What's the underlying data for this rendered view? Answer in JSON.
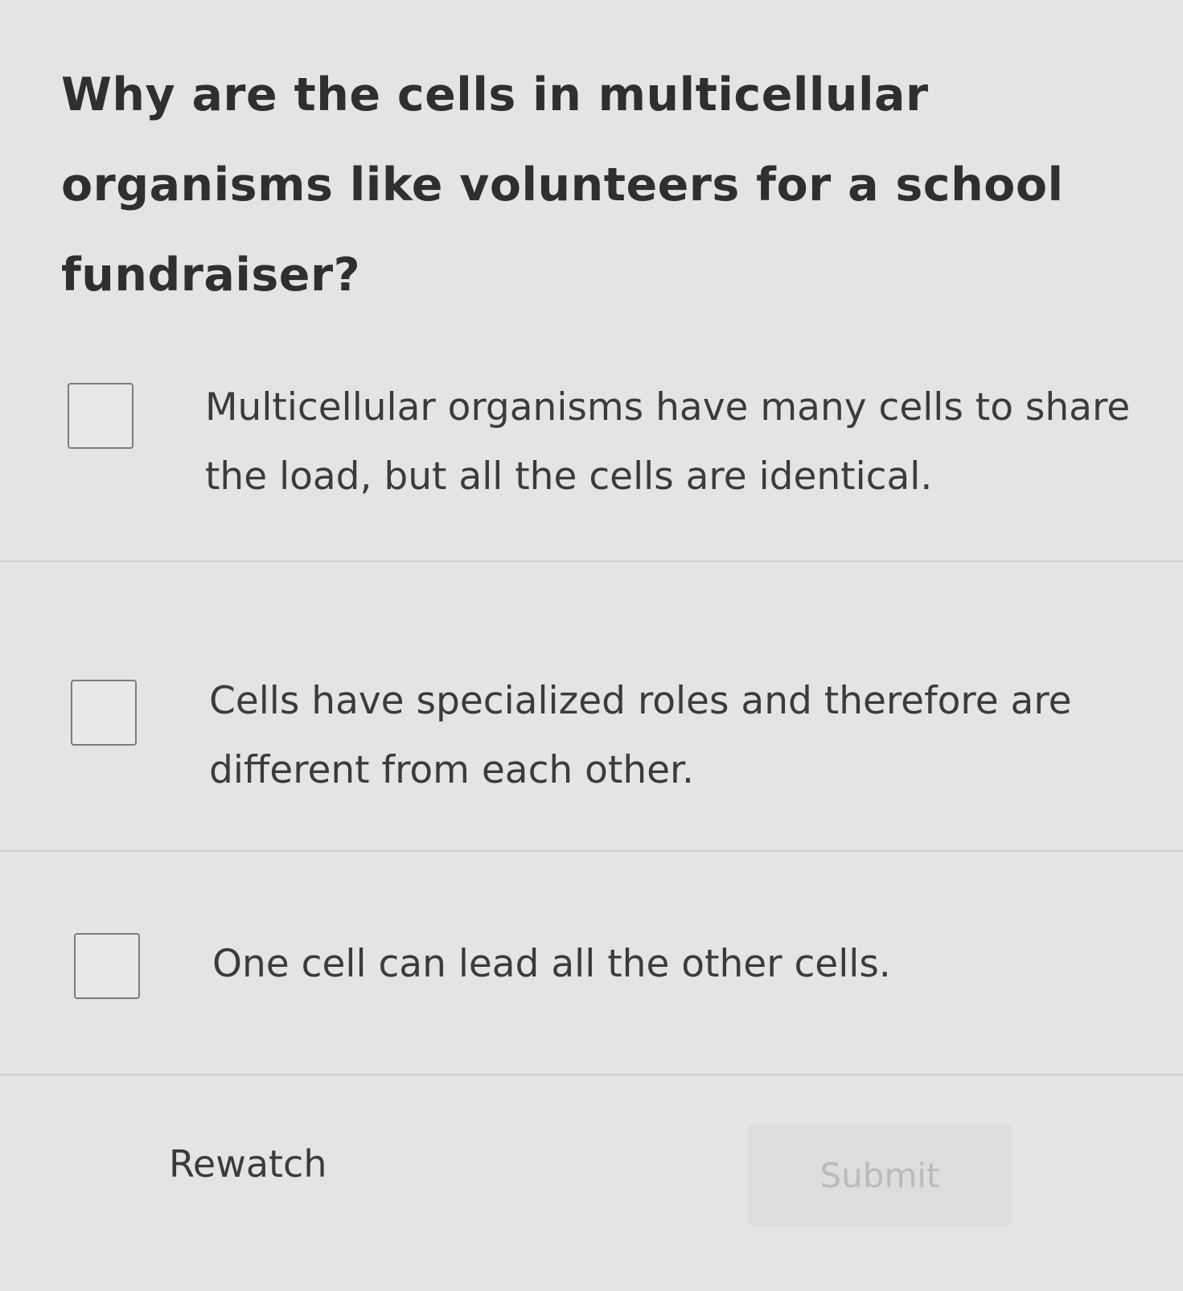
{
  "question": {
    "text": "Why are the cells in multicellular organisms like volunteers for a school fundraiser?"
  },
  "options": [
    {
      "label": "Multicellular organisms have many cells to share the load, but all the cells are identical.",
      "checked": false
    },
    {
      "label": "Cells have specialized roles and therefore are different from each other.",
      "checked": false
    },
    {
      "label": "One cell can lead all the other cells.",
      "checked": false
    }
  ],
  "actions": {
    "rewatch_label": "Rewatch",
    "submit_label": "Submit",
    "submit_enabled": false
  }
}
